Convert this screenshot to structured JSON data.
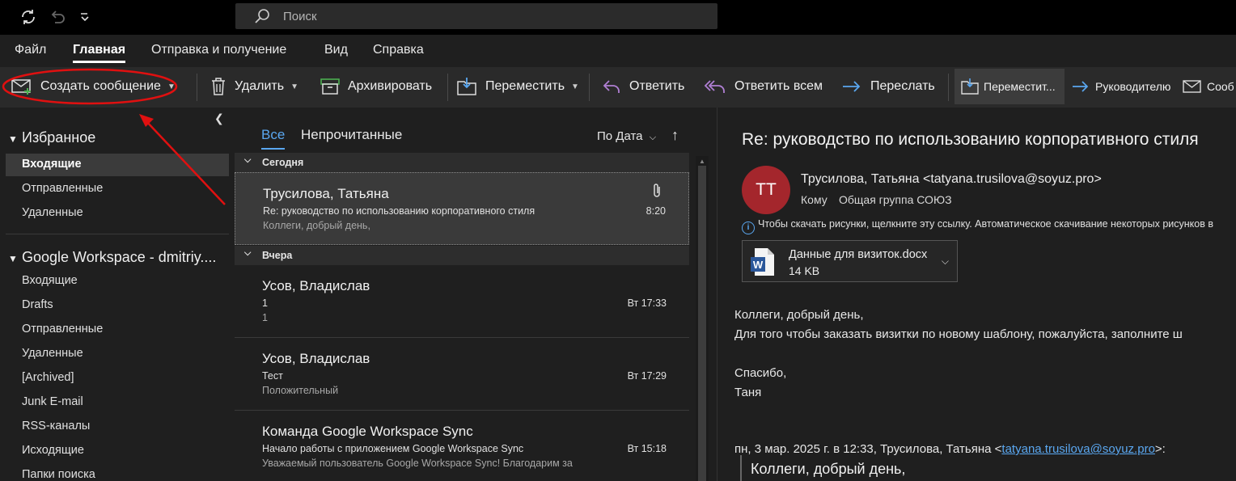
{
  "titlebar": {
    "search_placeholder": "Поиск"
  },
  "menu": {
    "tabs": [
      "Файл",
      "Главная",
      "Отправка и получение",
      "Вид",
      "Справка"
    ],
    "active": "Главная"
  },
  "ribbon": {
    "new_message": "Создать сообщение",
    "delete": "Удалить",
    "archive": "Архивировать",
    "move": "Переместить",
    "reply": "Ответить",
    "reply_all": "Ответить всем",
    "forward": "Переслать",
    "quick_move": "Переместит...",
    "to_manager": "Руководителю",
    "message": "Сооб"
  },
  "folders": {
    "favorites_title": "Избранное",
    "favorites": [
      "Входящие",
      "Отправленные",
      "Удаленные"
    ],
    "account_title": "Google Workspace - dmitriy....",
    "account_items": [
      "Входящие",
      "Drafts",
      "Отправленные",
      "Удаленные",
      "[Archived]",
      "Junk E-mail",
      "RSS-каналы",
      "Исходящие",
      "Папки поиска"
    ]
  },
  "list": {
    "tab_all": "Все",
    "tab_unread": "Непрочитанные",
    "sort_label": "По Дата",
    "group_today": "Сегодня",
    "group_yesterday": "Вчера",
    "messages": [
      {
        "from": "Трусилова, Татьяна",
        "subject": "Re: руководство по использованию корпоративного стиля",
        "preview": "Коллеги, добрый день,",
        "time": "8:20"
      },
      {
        "from": "Усов, Владислав",
        "subject": "1",
        "preview": "1",
        "time": "Вт 17:33"
      },
      {
        "from": "Усов, Владислав",
        "subject": "Тест",
        "preview": "Положительный",
        "time": "Вт 17:29"
      },
      {
        "from": "Команда Google Workspace Sync",
        "subject": "Начало работы с приложением Google Workspace Sync",
        "preview": "Уважаемый пользователь Google Workspace Sync!  Благодарим за",
        "time": "Вт 15:18"
      }
    ]
  },
  "reading": {
    "subject": "Re: руководство по использованию корпоративного стиля",
    "avatar_initials": "ТТ",
    "from": "Трусилова, Татьяна <tatyana.trusilova@soyuz.pro>",
    "to_label": "Кому",
    "to": "Общая группа СОЮЗ",
    "info_text": "Чтобы скачать рисунки, щелкните эту ссылку. Автоматическое скачивание некоторых рисунков в",
    "attachment_name": "Данные для визиток.docx",
    "attachment_size": "14 KB",
    "body": [
      "Коллеги, добрый день,",
      "Для того чтобы заказать визитки по новому шаблону, пожалуйста, заполните ш",
      "Спасибо,",
      "Таня"
    ],
    "quote_header_prefix": "пн, 3 мар. 2025 г. в 12:33, Трусилова, Татьяна <",
    "quote_header_email": "tatyana.trusilova@soyuz.pro",
    "quote_header_suffix": ">:",
    "quote_first_line": "Коллеги, добрый день,"
  },
  "colors": {
    "accent": "#5aa7f0",
    "avatar": "#a4262c",
    "annotation": "#e01010"
  }
}
